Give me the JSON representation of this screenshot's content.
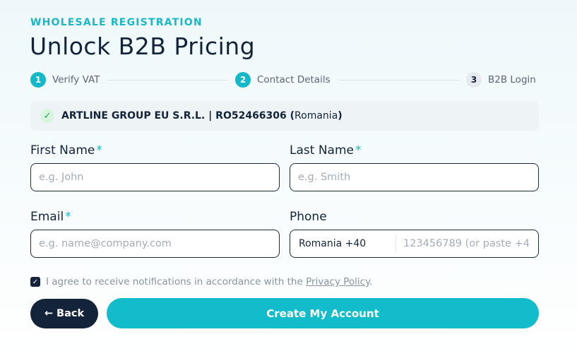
{
  "header": {
    "eyebrow": "WHOLESALE REGISTRATION",
    "title": "Unlock B2B Pricing"
  },
  "stepper": {
    "steps": [
      {
        "number": "1",
        "label": "Verify VAT",
        "state": "complete"
      },
      {
        "number": "2",
        "label": "Contact Details",
        "state": "active"
      },
      {
        "number": "3",
        "label": "B2B Login",
        "state": "pending"
      }
    ]
  },
  "company": {
    "icon": "check-icon",
    "prefix": "ARTLINE GROUP EU S.R.L. | RO52466306 (",
    "country": "Romania",
    "suffix": ")"
  },
  "form": {
    "first_name": {
      "label": "First Name",
      "required": "*",
      "placeholder": "e.g. John",
      "value": ""
    },
    "last_name": {
      "label": "Last Name",
      "required": "*",
      "placeholder": "e.g. Smith",
      "value": ""
    },
    "email": {
      "label": "Email",
      "required": "*",
      "placeholder": "e.g. name@company.com",
      "value": ""
    },
    "phone": {
      "label": "Phone",
      "country": "Romania +40",
      "placeholder": "123456789 (or paste +4",
      "value": ""
    }
  },
  "consent": {
    "checked": true,
    "text": "I agree to receive notifications in accordance with the ",
    "link": "Privacy Policy",
    "end": "."
  },
  "actions": {
    "back_label": "← Back",
    "create_label": "Create My Account"
  },
  "colors": {
    "accent": "#15b8c8",
    "dark": "#13233a"
  }
}
